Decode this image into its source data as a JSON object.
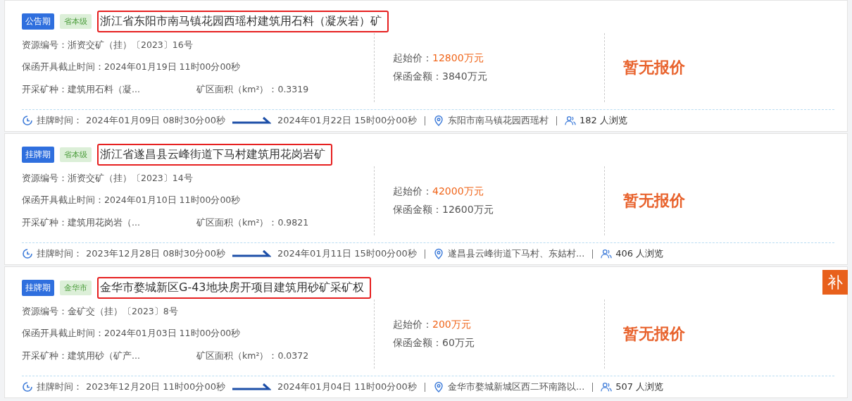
{
  "listings": [
    {
      "stage": "公告期",
      "level_tag": "省本级",
      "title": "浙江省东阳市南马镇花园西瑶村建筑用石料（凝灰岩）矿",
      "highlighted": true,
      "resource_no": "资源编号：浙资交矿（挂）〔2023〕16号",
      "guarantee_deadline": "保函开具截止时间：2024年01月19日 11时00分00秒",
      "mineral": "开采矿种：建筑用石料（凝...",
      "area": "矿区面积（km²）：0.3319",
      "start_price_label": "起始价：",
      "start_price": "12800万元",
      "guarantee_amount": "保函金额：3840万元",
      "bid_status": "暂无报价",
      "listing_label": "挂牌时间：",
      "listing_start": "2024年01月09日 08时30分00秒",
      "listing_end": "2024年01月22日 15时00分00秒",
      "location": "东阳市南马镇花园西瑶村",
      "views": "182 人浏览"
    },
    {
      "stage": "挂牌期",
      "level_tag": "省本级",
      "title": "浙江省遂昌县云峰街道下马村建筑用花岗岩矿",
      "highlighted": true,
      "resource_no": "资源编号：浙资交矿（挂）〔2023〕14号",
      "guarantee_deadline": "保函开具截止时间：2024年01月10日 11时00分00秒",
      "mineral": "开采矿种：建筑用花岗岩（...",
      "area": "矿区面积（km²）：0.9821",
      "start_price_label": "起始价：",
      "start_price": "42000万元",
      "guarantee_amount": "保函金额：12600万元",
      "bid_status": "暂无报价",
      "listing_label": "挂牌时间：",
      "listing_start": "2023年12月28日 08时30分00秒",
      "listing_end": "2024年01月11日 15时00分00秒",
      "location": "遂昌县云峰街道下马村、东姑村...",
      "views": "406 人浏览"
    },
    {
      "stage": "挂牌期",
      "level_tag": "金华市",
      "title": "金华市婺城新区G-43地块房开项目建筑用砂矿采矿权",
      "highlighted": true,
      "resource_no": "资源编号：金矿交（挂）〔2023〕8号",
      "guarantee_deadline": "保函开具截止时间：2024年01月03日 11时00分00秒",
      "mineral": "开采矿种：建筑用砂（矿产...",
      "area": "矿区面积（km²）：0.0372",
      "start_price_label": "起始价：",
      "start_price": "200万元",
      "guarantee_amount": "保函金额：60万元",
      "bid_status": "暂无报价",
      "listing_label": "挂牌时间：",
      "listing_start": "2023年12月20日 11时00分00秒",
      "listing_end": "2024年01月04日 11时00分00秒",
      "location": "金华市婺城新城区西二环南路以...",
      "views": "507 人浏览"
    }
  ],
  "float_button": "补"
}
